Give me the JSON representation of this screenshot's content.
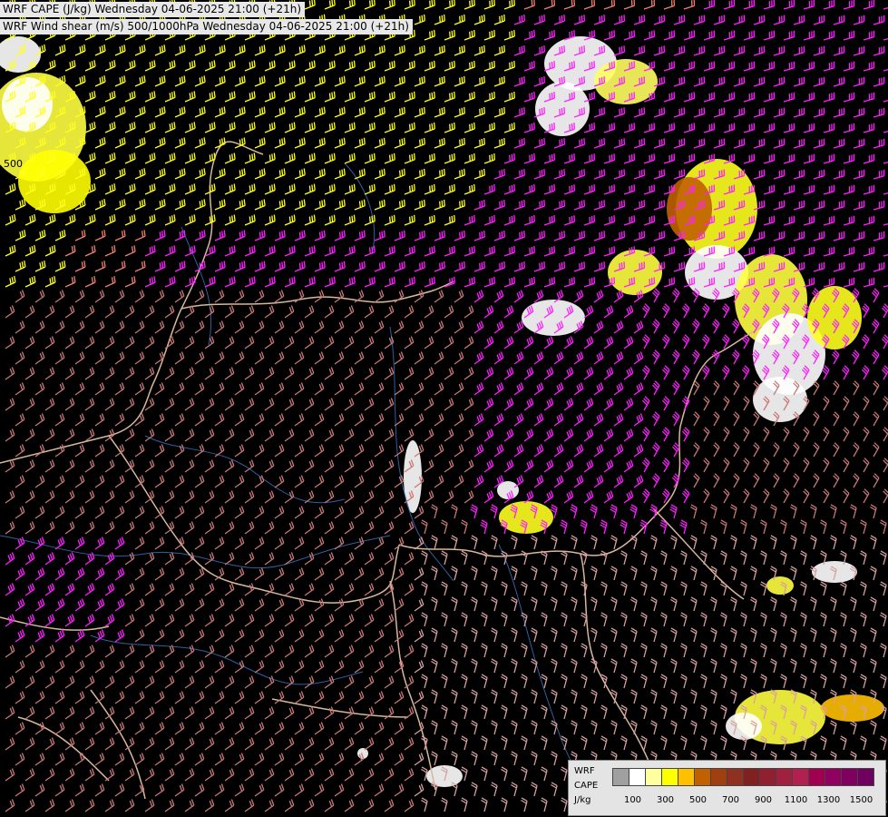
{
  "titles": {
    "line1": "WRF CAPE (J/kg) Wednesday 04-06-2025 21:00 (+21h)",
    "line2": "WRF Wind shear (m/s) 500/1000hPa Wednesday 04-06-2025 21:00 (+21h)"
  },
  "map_label": "500",
  "legend": {
    "model": "WRF",
    "field": "CAPE",
    "unit": "J/kg",
    "ticks": [
      "100",
      "300",
      "500",
      "700",
      "900",
      "1100",
      "1300",
      "1500"
    ],
    "colors": [
      "#a0a0a0",
      "#ffffff",
      "#ffffa0",
      "#ffff00",
      "#ffc000",
      "#c06000",
      "#a04010",
      "#903020",
      "#802020",
      "#902030",
      "#a02040",
      "#b02050",
      "#a00050",
      "#900060",
      "#800060",
      "#700060"
    ]
  },
  "colors": {
    "barb_yellow": "#ffff20",
    "barb_magenta": "#ff20ff",
    "barb_salmon": "#f08070",
    "barb_rose": "#c87878",
    "barb_lightrose": "#d8a0a0",
    "barb_gray": "#a0a0a0",
    "border": "#d8b898",
    "river": "#3060a0"
  }
}
